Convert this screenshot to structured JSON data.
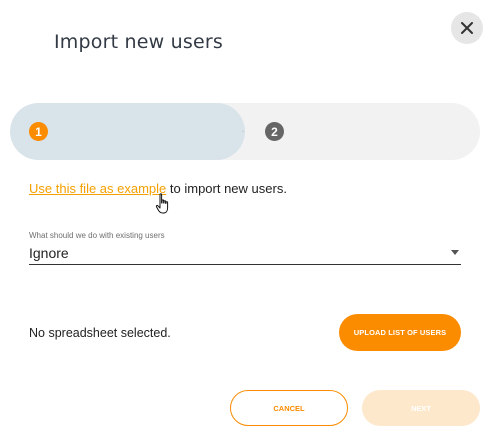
{
  "dialog": {
    "title": "Import new users"
  },
  "stepper": {
    "steps": [
      {
        "number": "1",
        "active": true
      },
      {
        "number": "2",
        "active": false
      }
    ]
  },
  "info": {
    "link_text": "Use this file as example",
    "rest_text": " to import new users."
  },
  "existing_users_field": {
    "label": "What should we do with existing users",
    "value": "Ignore"
  },
  "upload": {
    "status_text": "No spreadsheet selected.",
    "button_label": "UPLOAD LIST OF USERS"
  },
  "footer": {
    "cancel_label": "CANCEL",
    "next_label": "NEXT"
  },
  "colors": {
    "accent": "#fb8c00",
    "link": "#f5a000",
    "step_active_bg": "#d9e3ea",
    "step_inactive_bg": "#f2f2f2",
    "disabled_button": "#fde8cc"
  }
}
